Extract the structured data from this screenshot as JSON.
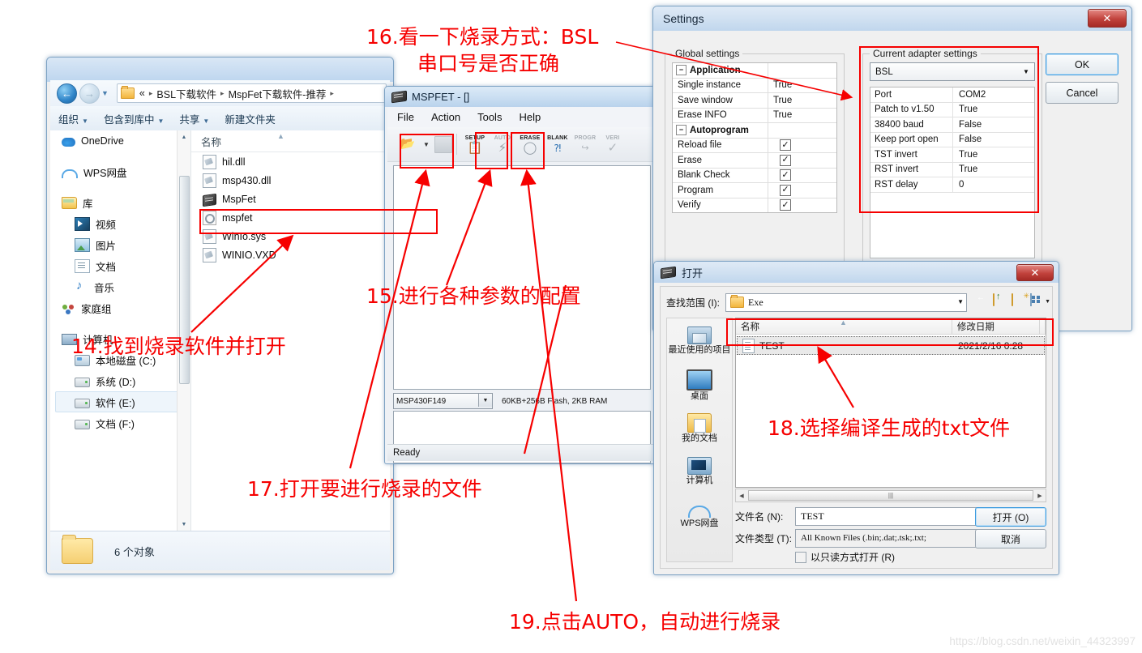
{
  "explorer": {
    "nav": {
      "back_icon": "back-arrow",
      "forward_icon": "forward-arrow"
    },
    "breadcrumb": {
      "overflow": "«",
      "parts": [
        "BSL下载软件",
        "MspFet下载软件-推荐"
      ],
      "sep": "▸"
    },
    "toolbar": [
      "组织",
      "包含到库中",
      "共享",
      "新建文件夹"
    ],
    "tree": [
      {
        "label": "OneDrive",
        "icon": "onedrive-icon",
        "indent": 0
      },
      {
        "label": "WPS网盘",
        "icon": "wps-cloud-icon",
        "indent": 0
      },
      {
        "label": "库",
        "icon": "library-icon",
        "indent": 0
      },
      {
        "label": "视频",
        "icon": "video-icon",
        "indent": 1
      },
      {
        "label": "图片",
        "icon": "picture-icon",
        "indent": 1
      },
      {
        "label": "文档",
        "icon": "document-icon",
        "indent": 1
      },
      {
        "label": "音乐",
        "icon": "music-icon",
        "indent": 1
      },
      {
        "label": "家庭组",
        "icon": "homegroup-icon",
        "indent": 0
      },
      {
        "label": "计算机",
        "icon": "computer-icon",
        "indent": 0
      },
      {
        "label": "本地磁盘 (C:)",
        "icon": "local-disk-icon",
        "indent": 1
      },
      {
        "label": "系统 (D:)",
        "icon": "hard-drive-icon",
        "indent": 1
      },
      {
        "label": "软件 (E:)",
        "icon": "hard-drive-icon",
        "indent": 1,
        "selected": true
      },
      {
        "label": "文档 (F:)",
        "icon": "hard-drive-icon",
        "indent": 1
      }
    ],
    "files_header": "名称",
    "files": [
      {
        "name": "hil.dll",
        "icon": "dll-icon"
      },
      {
        "name": "msp430.dll",
        "icon": "dll-icon"
      },
      {
        "name": "MspFet",
        "icon": "exe-icon",
        "highlighted": true
      },
      {
        "name": "mspfet",
        "icon": "config-icon"
      },
      {
        "name": "WinIo.sys",
        "icon": "dll-icon"
      },
      {
        "name": "WINIO.VXD",
        "icon": "dll-icon"
      }
    ],
    "status": "6 个对象"
  },
  "mspfet": {
    "title": "MSPFET - []",
    "menu": [
      "File",
      "Action",
      "Tools",
      "Help"
    ],
    "toolbar": [
      {
        "label": "",
        "icon": "open-folder-icon",
        "enabled": true
      },
      {
        "label": "",
        "icon": "save-icon",
        "enabled": false
      },
      {
        "label": "SETUP",
        "icon": "setup-icon",
        "enabled": true
      },
      {
        "label": "AUTO",
        "icon": "auto-lightning-icon",
        "enabled": false
      },
      {
        "label": "ERASE",
        "icon": "eraser-icon",
        "enabled": true
      },
      {
        "label": "BLANK",
        "icon": "blank-check-icon",
        "enabled": true
      },
      {
        "label": "PROGR",
        "icon": "program-icon",
        "enabled": false
      },
      {
        "label": "VERI",
        "icon": "verify-check-icon",
        "enabled": false
      }
    ],
    "device": "MSP430F149",
    "device_info": "60KB+256B Flash, 2KB RAM",
    "status": "Ready"
  },
  "settings": {
    "title": "Settings",
    "close_icon": "close-x-icon",
    "global_group_label": "Global settings",
    "global_rows": [
      {
        "type": "category",
        "expander": "−",
        "name": "Application"
      },
      {
        "type": "value",
        "name": "Single instance",
        "value": "True"
      },
      {
        "type": "value",
        "name": "Save window",
        "value": "True"
      },
      {
        "type": "value",
        "name": "Erase INFO",
        "value": "True"
      },
      {
        "type": "category",
        "expander": "−",
        "name": "Autoprogram"
      },
      {
        "type": "check",
        "name": "Reload file",
        "checked": true
      },
      {
        "type": "check",
        "name": "Erase",
        "checked": true
      },
      {
        "type": "check",
        "name": "Blank Check",
        "checked": true
      },
      {
        "type": "check",
        "name": "Program",
        "checked": true
      },
      {
        "type": "check",
        "name": "Verify",
        "checked": true
      }
    ],
    "adapter_group_label": "Current adapter settings",
    "adapter_selected": "BSL",
    "adapter_rows": [
      {
        "name": "Port",
        "value": "COM2"
      },
      {
        "name": "Patch to v1.50",
        "value": "True"
      },
      {
        "name": "38400 baud",
        "value": "False"
      },
      {
        "name": "Keep port open",
        "value": "False"
      },
      {
        "name": "TST invert",
        "value": "True"
      },
      {
        "name": "RST invert",
        "value": "True"
      },
      {
        "name": "RST delay",
        "value": "0"
      }
    ],
    "ok_label": "OK",
    "cancel_label": "Cancel"
  },
  "opendlg": {
    "title": "打开",
    "close_icon": "close-x-icon",
    "lookin_label": "查找范围 (I):",
    "lookin_value": "Exe",
    "nav_icons": [
      "back-icon",
      "up-folder-icon",
      "new-folder-icon",
      "view-mode-icon"
    ],
    "columns": [
      "名称",
      "修改日期"
    ],
    "rows": [
      {
        "name": "TEST",
        "date": "2021/2/16 0:28",
        "icon": "text-file-icon",
        "selected": true
      }
    ],
    "sidebar": [
      {
        "label": "最近使用的项目",
        "icon": "recent-items-icon"
      },
      {
        "label": "桌面",
        "icon": "desktop-icon"
      },
      {
        "label": "我的文档",
        "icon": "my-documents-icon"
      },
      {
        "label": "计算机",
        "icon": "computer-icon"
      },
      {
        "label": "WPS网盘",
        "icon": "wps-cloud-icon"
      }
    ],
    "filename_label": "文件名 (N):",
    "filename_value": "TEST",
    "filetype_label": "文件类型 (T):",
    "filetype_value": "All Known Files (.bin;.dat;.tsk;.txt;",
    "readonly_label": "以只读方式打开 (R)",
    "open_button": "打开 (O)",
    "cancel_button": "取消"
  },
  "annotations": {
    "a14": "14.找到烧录软件并打开",
    "a15": "15.进行各种参数的配置",
    "a16_line1": "16.看一下烧录方式：BSL",
    "a16_line2": "串口号是否正确",
    "a17": "17.打开要进行烧录的文件",
    "a18": "18.选择编译生成的txt文件",
    "a19": "19.点击AUTO，自动进行烧录",
    "color": "#f60000"
  },
  "watermark": "https://blog.csdn.net/weixin_44323997"
}
